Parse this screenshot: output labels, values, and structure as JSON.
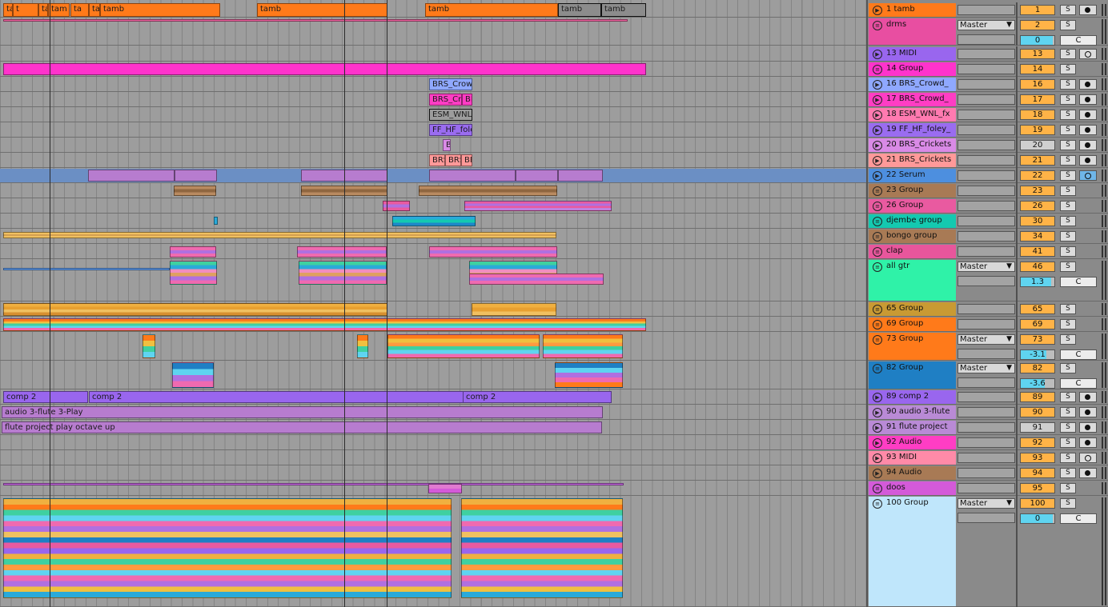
{
  "arrangement": {
    "top_clips": [
      "tamb",
      "t",
      "tamb",
      "tam",
      "ta",
      "tamb",
      "tamb",
      "tamb",
      "tamb",
      "tamb"
    ],
    "clip_labels": {
      "brs_crowd_16": "BRS_Crowd",
      "brs_cr_17": "BRS_Cr",
      "brs_17b": "BR",
      "esm_wnl": "ESM_WNL",
      "ff_hf": "FF_HF_fole",
      "b20": "B",
      "brs_21a": "BRS",
      "brs_21b": "BRS",
      "brs_21c": "BF",
      "comp2_a": "comp 2",
      "comp2_b": "comp 2",
      "comp2_c": "comp 2",
      "flute_audio": "audio 3-flute 3-Play",
      "flute_project": "flute project play octave up"
    }
  },
  "tracks": [
    {
      "name": "1  tamb",
      "color": "#ff7a1a",
      "icon": "play-icon",
      "num": "1",
      "solo": "S",
      "arm": "record-dot",
      "num_style": "orange"
    },
    {
      "name": "drms",
      "color": "#e84ea1",
      "icon": "group-icon",
      "num": "2",
      "solo": "S",
      "output": "Master",
      "volume": "0",
      "vol_fill": 0.95,
      "pan": "C",
      "tall": true
    },
    {
      "name": "13 MIDI",
      "color": "#9966ee",
      "icon": "play-icon",
      "num": "13",
      "solo": "S",
      "arm": "midi-arm",
      "num_style": "orange"
    },
    {
      "name": "14 Group",
      "color": "#ff33cc",
      "icon": "group-icon",
      "num": "14",
      "solo": "S",
      "num_style": "orange"
    },
    {
      "name": "16 BRS_Crowd_",
      "color": "#8fa8ff",
      "icon": "play-icon",
      "num": "16",
      "solo": "S",
      "arm": "record-dot",
      "num_style": "orange"
    },
    {
      "name": "17 BRS_Crowd_",
      "color": "#ff3dc4",
      "icon": "play-icon",
      "num": "17",
      "solo": "S",
      "arm": "record-dot",
      "num_style": "orange"
    },
    {
      "name": "18 ESM_WNL_fx",
      "color": "#ff7ab0",
      "icon": "play-icon",
      "num": "18",
      "solo": "S",
      "arm": "record-dot",
      "num_style": "orange"
    },
    {
      "name": "19 FF_HF_foley_",
      "color": "#9a6cf0",
      "icon": "play-icon",
      "num": "19",
      "solo": "S",
      "arm": "record-dot",
      "num_style": "orange"
    },
    {
      "name": "20 BRS_Crickets",
      "color": "#d98ae6",
      "icon": "play-icon",
      "num": "20",
      "solo": "S",
      "arm": "record-dot",
      "num_style": "grey"
    },
    {
      "name": "21 BRS_Crickets",
      "color": "#ff9999",
      "icon": "play-icon",
      "num": "21",
      "solo": "S",
      "arm": "record-dot",
      "num_style": "orange"
    },
    {
      "name": "22 Serum",
      "color": "#4d8fdf",
      "icon": "play-icon",
      "num": "22",
      "solo": "S",
      "arm": "midi-arm-blue",
      "num_style": "orange"
    },
    {
      "name": "23 Group",
      "color": "#a87a55",
      "icon": "group-icon",
      "num": "23",
      "solo": "S",
      "num_style": "orange"
    },
    {
      "name": "26 Group",
      "color": "#e95aa0",
      "icon": "group-icon",
      "num": "26",
      "solo": "S",
      "num_style": "orange"
    },
    {
      "name": "djembe group",
      "color": "#14c9b0",
      "icon": "group-icon",
      "num": "30",
      "solo": "S",
      "num_style": "orange"
    },
    {
      "name": "bongo group",
      "color": "#a87a55",
      "icon": "group-icon",
      "num": "34",
      "solo": "S",
      "num_style": "orange"
    },
    {
      "name": "clap",
      "color": "#e8569c",
      "icon": "group-icon",
      "num": "41",
      "solo": "S",
      "num_style": "orange"
    },
    {
      "name": "all gtr",
      "color": "#2ff2a8",
      "icon": "group-icon",
      "num": "46",
      "solo": "S",
      "output": "Master",
      "volume": "1.3",
      "vol_fill": 0.9,
      "pan": "C",
      "tall": true
    },
    {
      "name": "65 Group",
      "color": "#c99a33",
      "icon": "group-icon",
      "num": "65",
      "solo": "S",
      "num_style": "orange"
    },
    {
      "name": "69 Group",
      "color": "#ff7a1a",
      "icon": "group-icon",
      "num": "69",
      "solo": "S",
      "num_style": "orange"
    },
    {
      "name": "73 Group",
      "color": "#ff7a1a",
      "icon": "group-icon",
      "num": "73",
      "solo": "S",
      "output": "Master",
      "volume": "-3.1",
      "vol_fill": 0.75,
      "pan": "C",
      "tall": true
    },
    {
      "name": "82 Group",
      "color": "#1f7fc4",
      "icon": "group-icon",
      "num": "82",
      "solo": "S",
      "output": "Master",
      "volume": "-3.6",
      "vol_fill": 0.72,
      "pan": "C",
      "tall": true
    },
    {
      "name": "89 comp 2",
      "color": "#9966ee",
      "icon": "play-icon",
      "num": "89",
      "solo": "S",
      "arm": "record-dot",
      "num_style": "orange"
    },
    {
      "name": "90 audio 3-flute",
      "color": "#b98ad6",
      "icon": "play-icon",
      "num": "90",
      "solo": "S",
      "arm": "record-dot",
      "num_style": "orange"
    },
    {
      "name": "91 flute project",
      "color": "#b98ad6",
      "icon": "play-icon",
      "num": "91",
      "solo": "S",
      "arm": "record-dot",
      "num_style": "grey"
    },
    {
      "name": "92 Audio",
      "color": "#ff3dc4",
      "icon": "play-icon",
      "num": "92",
      "solo": "S",
      "arm": "record-dot",
      "num_style": "orange"
    },
    {
      "name": "93 MIDI",
      "color": "#ff8aa8",
      "icon": "play-icon",
      "num": "93",
      "solo": "S",
      "arm": "midi-arm",
      "num_style": "orange"
    },
    {
      "name": "94 Audio",
      "color": "#a87a55",
      "icon": "play-icon",
      "num": "94",
      "solo": "S",
      "arm": "record-dot",
      "num_style": "orange"
    },
    {
      "name": "doos",
      "color": "#d45ad9",
      "icon": "group-icon",
      "num": "95",
      "solo": "S",
      "num_style": "orange"
    },
    {
      "name": "100 Group",
      "color": "#bfe6fb",
      "icon": "group-icon",
      "num": "100",
      "solo": "S",
      "output": "Master",
      "volume": "0",
      "vol_fill": 0.95,
      "pan": "C",
      "tall": true,
      "last": true
    }
  ],
  "colors": {
    "orange": "#ff7a1a",
    "pink": "#e84ea1",
    "magenta": "#ff33cc",
    "purple": "#9966ee",
    "serum_blue": "#6b8fc4"
  }
}
